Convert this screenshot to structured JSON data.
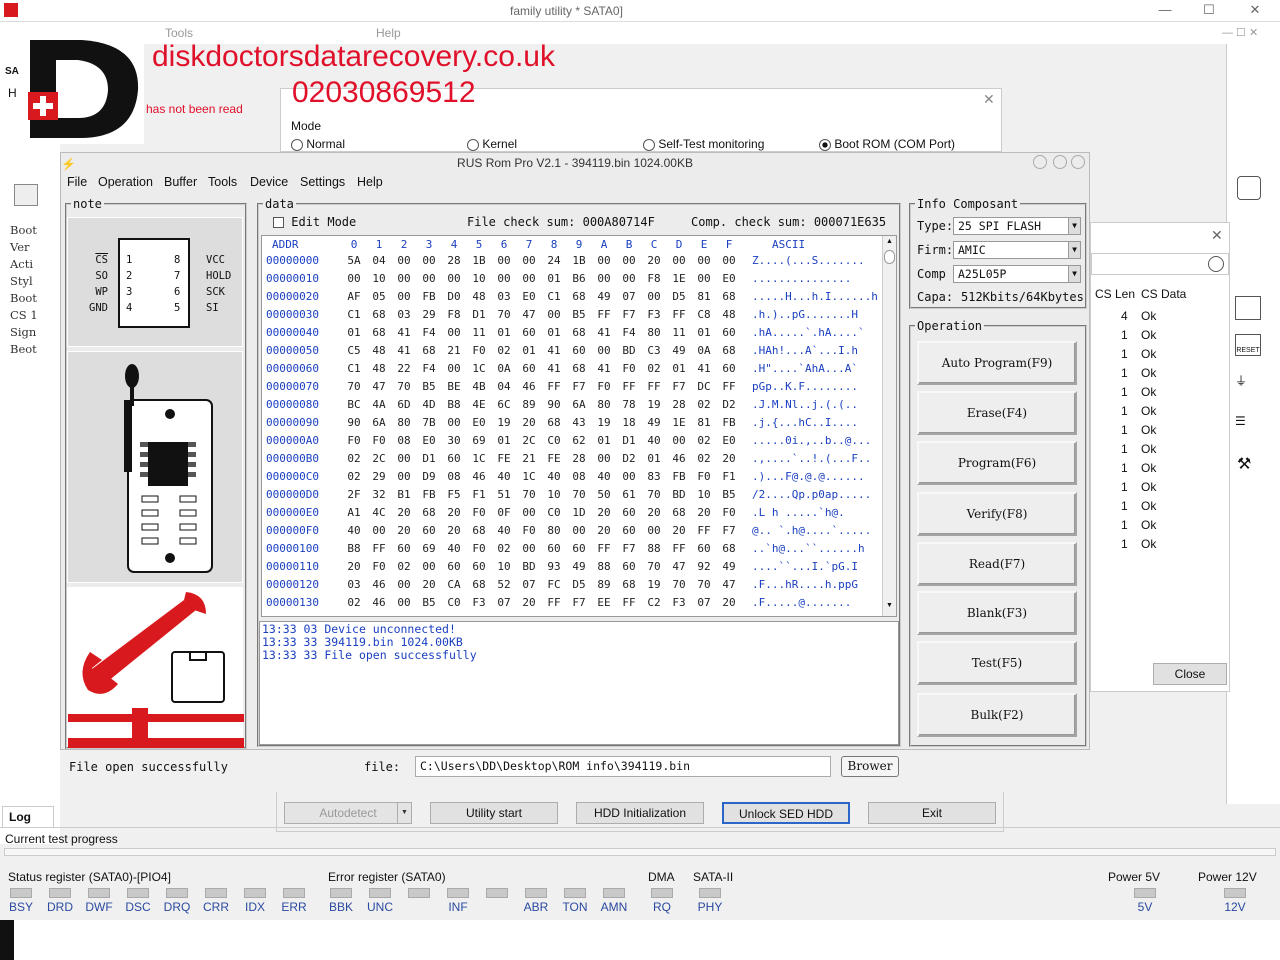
{
  "outer": {
    "title": "family utility * SATA0]",
    "menu": [
      "Tools",
      "Help"
    ],
    "left_labels": [
      "SA",
      "H"
    ],
    "close": "✕",
    "max": "☐",
    "min": "—"
  },
  "watermark": {
    "site": "diskdoctorsdatarecovery.co.uk",
    "phone": "02030869512",
    "not_read": "has not been read"
  },
  "mode_popup": {
    "label": "Mode",
    "options": [
      {
        "label": "Normal",
        "selected": false
      },
      {
        "label": "Kernel",
        "selected": false
      },
      {
        "label": "Self-Test monitoring",
        "selected": false
      },
      {
        "label": "Boot ROM (COM Port)",
        "selected": true
      }
    ]
  },
  "left_sidebar_text": [
    "Boot",
    "Ver",
    "Acti",
    "Styl",
    "Boot",
    "CS 1",
    "Sign",
    "Beot"
  ],
  "rus": {
    "title": "RUS Rom Pro V2.1 - 394119.bin  1024.00KB",
    "menu": [
      "File",
      "Operation",
      "Buffer",
      "Tools",
      "Device",
      "Settings",
      "Help"
    ],
    "note_label": "note",
    "data_label": "data",
    "edit_mode": "Edit Mode",
    "file_checksum": "File check sum: 000A80714F",
    "comp_checksum": "Comp. check sum: 000071E635",
    "chip": {
      "left_pins": [
        "CS",
        "SO",
        "WP",
        "GND"
      ],
      "left_nums": [
        "1",
        "2",
        "3",
        "4"
      ],
      "right_nums": [
        "8",
        "7",
        "6",
        "5"
      ],
      "right_pins": [
        "VCC",
        "HOLD",
        "SCK",
        "SI"
      ]
    },
    "hex_header": {
      "addr": "ADDR",
      "cols": [
        "0",
        "1",
        "2",
        "3",
        "4",
        "5",
        "6",
        "7",
        "8",
        "9",
        "A",
        "B",
        "C",
        "D",
        "E",
        "F"
      ],
      "ascii": "ASCII"
    },
    "hex_rows": [
      {
        "a": "00000000",
        "b": [
          "5A",
          "04",
          "00",
          "00",
          "28",
          "1B",
          "00",
          "00",
          "24",
          "1B",
          "00",
          "00",
          "20",
          "00",
          "00",
          "00"
        ],
        "s": "Z....(...S......."
      },
      {
        "a": "00000010",
        "b": [
          "00",
          "10",
          "00",
          "00",
          "00",
          "10",
          "00",
          "00",
          "01",
          "B6",
          "00",
          "00",
          "F8",
          "1E",
          "00",
          "E0"
        ],
        "s": "..............."
      },
      {
        "a": "00000020",
        "b": [
          "AF",
          "05",
          "00",
          "FB",
          "D0",
          "48",
          "03",
          "E0",
          "C1",
          "68",
          "49",
          "07",
          "00",
          "D5",
          "81",
          "68"
        ],
        "s": ".....H...h.I......h"
      },
      {
        "a": "00000030",
        "b": [
          "C1",
          "68",
          "03",
          "29",
          "F8",
          "D1",
          "70",
          "47",
          "00",
          "B5",
          "FF",
          "F7",
          "F3",
          "FF",
          "C8",
          "48"
        ],
        "s": ".h.)..pG.......H"
      },
      {
        "a": "00000040",
        "b": [
          "01",
          "68",
          "41",
          "F4",
          "00",
          "11",
          "01",
          "60",
          "01",
          "68",
          "41",
          "F4",
          "80",
          "11",
          "01",
          "60"
        ],
        "s": ".hA.....`.hA....`"
      },
      {
        "a": "00000050",
        "b": [
          "C5",
          "48",
          "41",
          "68",
          "21",
          "F0",
          "02",
          "01",
          "41",
          "60",
          "00",
          "BD",
          "C3",
          "49",
          "0A",
          "68"
        ],
        "s": ".HAh!...A`...I.h"
      },
      {
        "a": "00000060",
        "b": [
          "C1",
          "48",
          "22",
          "F4",
          "00",
          "1C",
          "0A",
          "60",
          "41",
          "68",
          "41",
          "F0",
          "02",
          "01",
          "41",
          "60"
        ],
        "s": ".H\"....`AhA...A`"
      },
      {
        "a": "00000070",
        "b": [
          "70",
          "47",
          "70",
          "B5",
          "BE",
          "4B",
          "04",
          "46",
          "FF",
          "F7",
          "F0",
          "FF",
          "FF",
          "F7",
          "DC",
          "FF"
        ],
        "s": "pGp..K.F........"
      },
      {
        "a": "00000080",
        "b": [
          "BC",
          "4A",
          "6D",
          "4D",
          "B8",
          "4E",
          "6C",
          "89",
          "90",
          "6A",
          "80",
          "78",
          "19",
          "28",
          "02",
          "D2"
        ],
        "s": ".J.M.Nl..j.(.(.."
      },
      {
        "a": "00000090",
        "b": [
          "90",
          "6A",
          "80",
          "7B",
          "00",
          "E0",
          "19",
          "20",
          "68",
          "43",
          "19",
          "18",
          "49",
          "1E",
          "81",
          "FB"
        ],
        "s": ".j.{...hC..I...."
      },
      {
        "a": "000000A0",
        "b": [
          "F0",
          "F0",
          "08",
          "E0",
          "30",
          "69",
          "01",
          "2C",
          "C0",
          "62",
          "01",
          "D1",
          "40",
          "00",
          "02",
          "E0"
        ],
        "s": ".....0i.,..b..@..."
      },
      {
        "a": "000000B0",
        "b": [
          "02",
          "2C",
          "00",
          "D1",
          "60",
          "1C",
          "FE",
          "21",
          "FE",
          "28",
          "00",
          "D2",
          "01",
          "46",
          "02",
          "20"
        ],
        "s": ".,....`..!.(...F.."
      },
      {
        "a": "000000C0",
        "b": [
          "02",
          "29",
          "00",
          "D9",
          "08",
          "46",
          "40",
          "1C",
          "40",
          "08",
          "40",
          "00",
          "83",
          "FB",
          "F0",
          "F1"
        ],
        "s": ".)...F@.@.@......"
      },
      {
        "a": "000000D0",
        "b": [
          "2F",
          "32",
          "B1",
          "FB",
          "F5",
          "F1",
          "51",
          "70",
          "10",
          "70",
          "50",
          "61",
          "70",
          "BD",
          "10",
          "B5"
        ],
        "s": "/2....Qp.p0ap....."
      },
      {
        "a": "000000E0",
        "b": [
          "A1",
          "4C",
          "20",
          "68",
          "20",
          "F0",
          "0F",
          "00",
          "C0",
          "1D",
          "20",
          "60",
          "20",
          "68",
          "20",
          "F0"
        ],
        "s": ".L h .....`h@."
      },
      {
        "a": "000000F0",
        "b": [
          "40",
          "00",
          "20",
          "60",
          "20",
          "68",
          "40",
          "F0",
          "80",
          "00",
          "20",
          "60",
          "00",
          "20",
          "FF",
          "F7"
        ],
        "s": "@.. `.h@....`....."
      },
      {
        "a": "00000100",
        "b": [
          "B8",
          "FF",
          "60",
          "69",
          "40",
          "F0",
          "02",
          "00",
          "60",
          "60",
          "FF",
          "F7",
          "88",
          "FF",
          "60",
          "68"
        ],
        "s": "..`h@...``......h"
      },
      {
        "a": "00000110",
        "b": [
          "20",
          "F0",
          "02",
          "00",
          "60",
          "60",
          "10",
          "BD",
          "93",
          "49",
          "88",
          "60",
          "70",
          "47",
          "92",
          "49"
        ],
        "s": "....``...I.`pG.I"
      },
      {
        "a": "00000120",
        "b": [
          "03",
          "46",
          "00",
          "20",
          "CA",
          "68",
          "52",
          "07",
          "FC",
          "D5",
          "89",
          "68",
          "19",
          "70",
          "70",
          "47"
        ],
        "s": ".F...hR....h.ppG"
      },
      {
        "a": "00000130",
        "b": [
          "02",
          "46",
          "00",
          "B5",
          "C0",
          "F3",
          "07",
          "20",
          "FF",
          "F7",
          "EE",
          "FF",
          "C2",
          "F3",
          "07",
          "20"
        ],
        "s": ".F.....@......."
      }
    ],
    "log": [
      {
        "time": "13:33 03",
        "msg": "Device unconnected!"
      },
      {
        "time": "13:33 33",
        "msg": "394119.bin 1024.00KB"
      },
      {
        "time": "13:33 33",
        "msg": "File open successfully"
      }
    ],
    "status_msg": "File open successfully",
    "file_label": "file:",
    "file_path": "C:\\Users\\DD\\Desktop\\ROM info\\394119.bin",
    "browse": "Brower",
    "info_label": "Info Composant",
    "type_label": "Type:",
    "type_value": "25 SPI FLASH",
    "firm_label": "Firm:",
    "firm_value": "AMIC",
    "comp_label": "Comp",
    "comp_value": "A25L05P",
    "capa_label": "Capa:",
    "capa_value": "512Kbits/64Kbytes",
    "operation_label": "Operation",
    "operations": [
      "Auto Program(F9)",
      "Erase(F4)",
      "Program(F6)",
      "Verify(F8)",
      "Read(F7)",
      "Blank(F3)",
      "Test(F5)",
      "Bulk(F2)"
    ]
  },
  "cs_panel": {
    "headers": [
      "CS Len",
      "CS Data"
    ],
    "rows": [
      {
        "len": "4",
        "data": "Ok"
      },
      {
        "len": "1",
        "data": "Ok"
      },
      {
        "len": "1",
        "data": "Ok"
      },
      {
        "len": "1",
        "data": "Ok"
      },
      {
        "len": "1",
        "data": "Ok"
      },
      {
        "len": "1",
        "data": "Ok"
      },
      {
        "len": "1",
        "data": "Ok"
      },
      {
        "len": "1",
        "data": "Ok"
      },
      {
        "len": "1",
        "data": "Ok"
      },
      {
        "len": "1",
        "data": "Ok"
      },
      {
        "len": "1",
        "data": "Ok"
      },
      {
        "len": "1",
        "data": "Ok"
      },
      {
        "len": "1",
        "data": "Ok"
      }
    ],
    "close": "Close"
  },
  "bottom_buttons": {
    "autodetect": "Autodetect",
    "utility_start": "Utility start",
    "hdd_init": "HDD Initialization",
    "unlock": "Unlock SED HDD",
    "exit": "Exit"
  },
  "log_tab": "Log",
  "progress_label": "Current test progress",
  "status": {
    "status_reg_label": "Status register (SATA0)-[PIO4]",
    "error_reg_label": "Error register (SATA0)",
    "dma": "DMA",
    "sata": "SATA-II",
    "power5": "Power 5V",
    "power12": "Power 12V",
    "status_bits": [
      "BSY",
      "DRD",
      "DWF",
      "DSC",
      "DRQ",
      "CRR",
      "IDX",
      "ERR"
    ],
    "error_bits": [
      "BBK",
      "UNC",
      "",
      "INF",
      "",
      "ABR",
      "TON",
      "AMN"
    ],
    "dma_bits": [
      "RQ"
    ],
    "sata_bits": [
      "PHY"
    ],
    "p5": "5V",
    "p12": "12V"
  }
}
